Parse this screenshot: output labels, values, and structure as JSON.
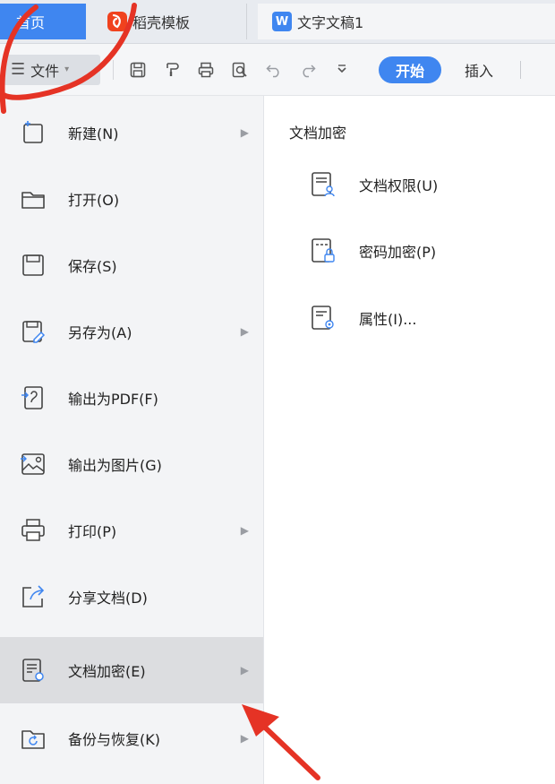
{
  "tabs": {
    "home": "首页",
    "template": "稻壳模板",
    "template_icon": "daoke-logo",
    "document": "文字文稿1",
    "document_icon_letter": "W"
  },
  "toolbar": {
    "file_label": "文件",
    "start_label": "开始",
    "insert_label": "插入",
    "accent_color": "#3f86f0"
  },
  "menu": {
    "items": [
      {
        "label": "新建(N)",
        "icon": "new-doc-icon",
        "has_submenu": true
      },
      {
        "label": "打开(O)",
        "icon": "folder-icon",
        "has_submenu": false
      },
      {
        "label": "保存(S)",
        "icon": "save-icon",
        "has_submenu": false
      },
      {
        "label": "另存为(A)",
        "icon": "save-as-icon",
        "has_submenu": true
      },
      {
        "label": "输出为PDF(F)",
        "icon": "pdf-icon",
        "has_submenu": false
      },
      {
        "label": "输出为图片(G)",
        "icon": "image-icon",
        "has_submenu": false
      },
      {
        "label": "打印(P)",
        "icon": "print-icon",
        "has_submenu": true
      },
      {
        "label": "分享文档(D)",
        "icon": "share-icon",
        "has_submenu": false
      },
      {
        "label": "文档加密(E)",
        "icon": "encrypt-doc-icon",
        "has_submenu": true,
        "active": true
      },
      {
        "label": "备份与恢复(K)",
        "icon": "backup-icon",
        "has_submenu": true
      }
    ]
  },
  "submenu": {
    "title": "文档加密",
    "items": [
      {
        "label": "文档权限(U)",
        "icon": "doc-permission-icon"
      },
      {
        "label": "密码加密(P)",
        "icon": "password-lock-icon"
      },
      {
        "label": "属性(I)...",
        "icon": "properties-icon"
      }
    ]
  }
}
